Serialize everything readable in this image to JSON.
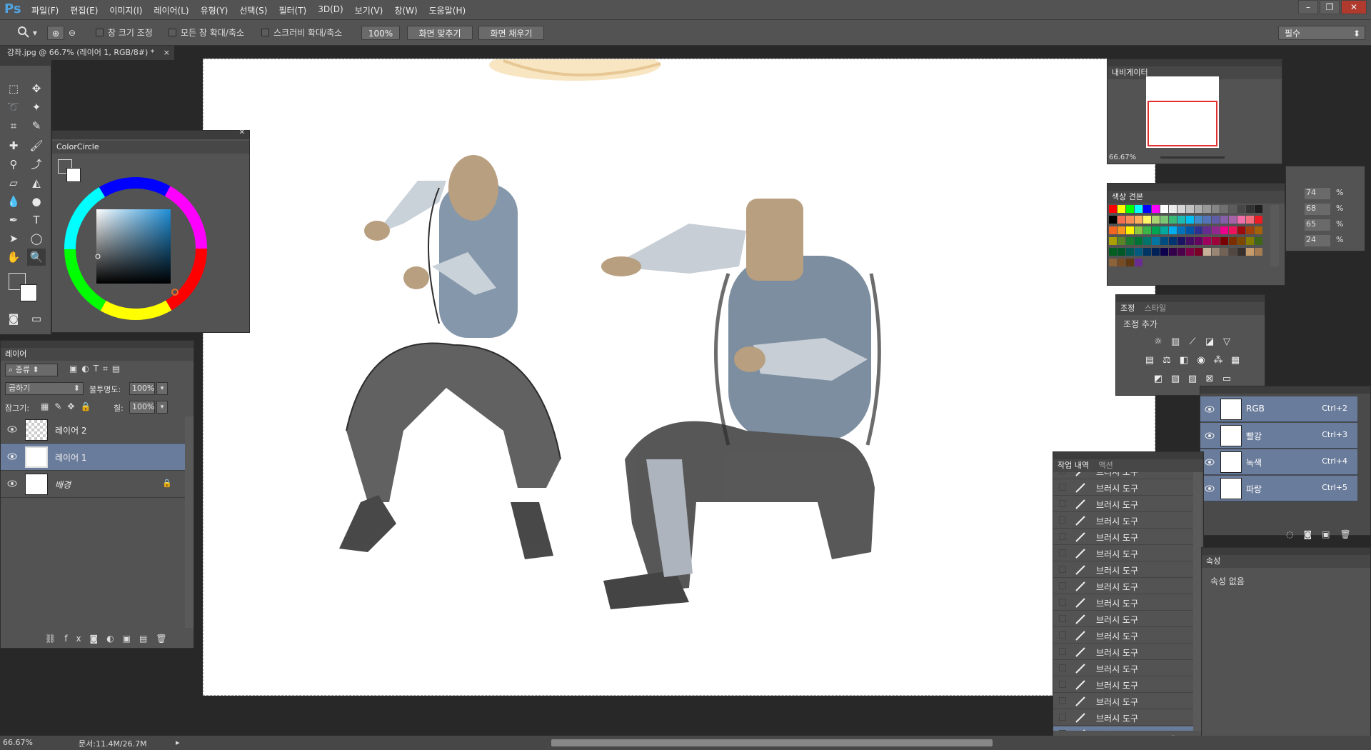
{
  "app": {
    "logo": "Ps"
  },
  "menu": [
    "파일(F)",
    "편집(E)",
    "이미지(I)",
    "레이어(L)",
    "유형(Y)",
    "선택(S)",
    "필터(T)",
    "3D(D)",
    "보기(V)",
    "창(W)",
    "도움말(H)"
  ],
  "options": {
    "resize_windows": "창 크기 조정",
    "zoom_all": "모든 창 확대/축소",
    "scrubby_zoom": "스크러비 확대/축소",
    "zoom_100": "100%",
    "fit_screen": "화면 맞추기",
    "fill_screen": "화면 채우기",
    "workspace": "필수"
  },
  "document": {
    "tab_title": "강좌.jpg @ 66.7% (레이어 1, RGB/8#) *",
    "close": "×"
  },
  "colorcircle": {
    "title": "ColorCircle"
  },
  "layers": {
    "tab": "레이어",
    "filter_kind": "종류",
    "blend_mode": "곱하기",
    "opacity_label": "불투명도:",
    "opacity_value": "100%",
    "lock_label": "잠그기:",
    "fill_label": "칠:",
    "fill_value": "100%",
    "items": [
      {
        "name": "레이어 2"
      },
      {
        "name": "레이어 1"
      },
      {
        "name": "배경"
      }
    ]
  },
  "navigator": {
    "tab": "내비게이터",
    "zoom": "66.67%"
  },
  "swatches": {
    "tab": "색상 견본"
  },
  "color_values": [
    "74",
    "68",
    "65",
    "24"
  ],
  "color_unit": "%",
  "adjust": {
    "tab_active": "조정",
    "tab_inactive": "스타일",
    "title": "조정 추가"
  },
  "channels": [
    {
      "name": "RGB",
      "shortcut": "Ctrl+2"
    },
    {
      "name": "빨강",
      "shortcut": "Ctrl+3"
    },
    {
      "name": "녹색",
      "shortcut": "Ctrl+4"
    },
    {
      "name": "파랑",
      "shortcut": "Ctrl+5"
    }
  ],
  "history": {
    "tab_active": "작업 내역",
    "tab_inactive": "액션",
    "items": [
      "브러시 도구",
      "브러시 도구",
      "브러시 도구",
      "브러시 도구",
      "브러시 도구",
      "브러시 도구",
      "브러시 도구",
      "브러시 도구",
      "브러시 도구",
      "브러시 도구",
      "브러시 도구",
      "브러시 도구",
      "브러시 도구",
      "브러시 도구",
      "브러시 도구",
      "브러시 도구",
      "브러시 도구"
    ]
  },
  "properties": {
    "tab": "속성",
    "empty": "속성 없음"
  },
  "status": {
    "zoom": "66.67%",
    "doc": "문서:11.4M/26.7M"
  },
  "colors": {
    "accent_selection": "#6a7c9b",
    "panel_bg": "#535353",
    "canvas": "#ffffff"
  }
}
